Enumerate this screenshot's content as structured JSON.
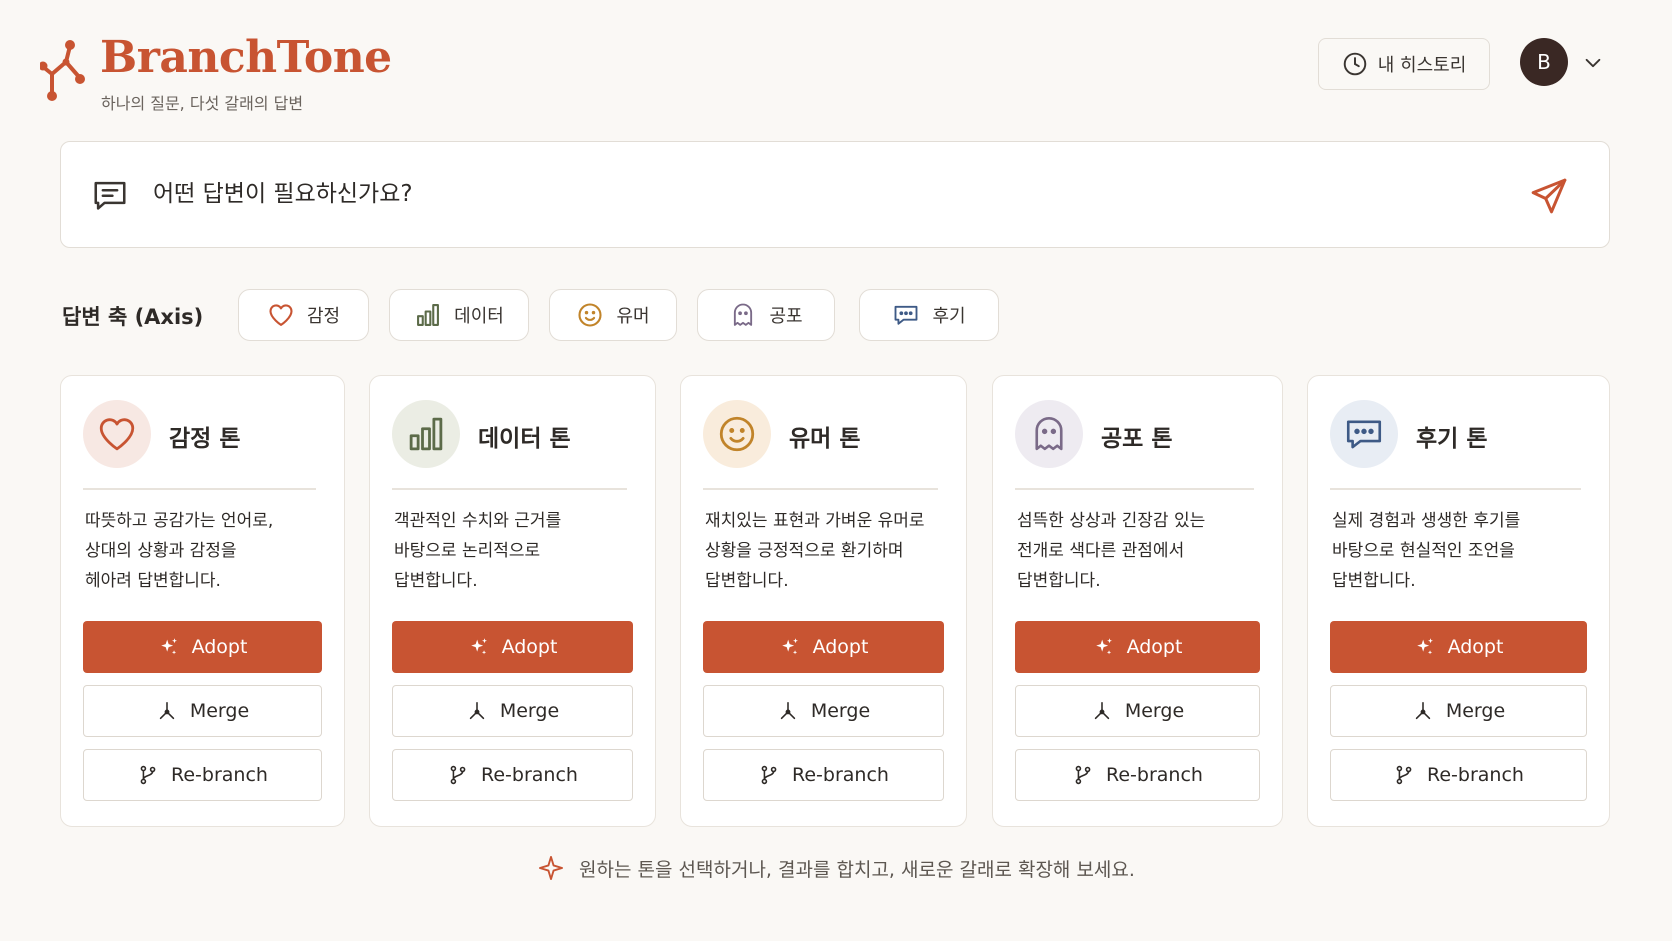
{
  "app": {
    "brand": "BranchTone",
    "tagline": "하나의 질문, 다섯 갈래의 답변",
    "accent_color": "#c85432",
    "logo_icon": "branch-nodes-icon"
  },
  "header": {
    "history_label": "내 히스토리",
    "history_icon": "clock-icon",
    "avatar_initial": "B",
    "menu_icon": "chevron-down-icon"
  },
  "search": {
    "placeholder": "어떤 답변이 필요하신가요?",
    "value": "",
    "left_icon": "chat-lines-icon",
    "send_icon": "send-icon"
  },
  "axis": {
    "label": "답변 축 (Axis)",
    "chips": [
      {
        "label": "감정",
        "icon": "heart-icon"
      },
      {
        "label": "데이터",
        "icon": "bar-chart-icon"
      },
      {
        "label": "유머",
        "icon": "smile-icon"
      },
      {
        "label": "공포",
        "icon": "ghost-icon"
      },
      {
        "label": "후기",
        "icon": "speech-bubble-icon"
      }
    ]
  },
  "cards": [
    {
      "title": "감정 톤",
      "icon": "heart-icon",
      "description": "따뜻하고 공감가는 언어로,\n상대의 상황과 감정을\n헤아려 답변합니다.",
      "adopt": "Adopt",
      "merge": "Merge",
      "rebranch": "Re-branch"
    },
    {
      "title": "데이터 톤",
      "icon": "bar-chart-icon",
      "description": "객관적인 수치와 근거를\n바탕으로 논리적으로\n답변합니다.",
      "adopt": "Adopt",
      "merge": "Merge",
      "rebranch": "Re-branch"
    },
    {
      "title": "유머 톤",
      "icon": "smile-icon",
      "description": "재치있는 표현과 가벼운 유머로\n상황을 긍정적으로 환기하며\n답변합니다.",
      "adopt": "Adopt",
      "merge": "Merge",
      "rebranch": "Re-branch"
    },
    {
      "title": "공포 톤",
      "icon": "ghost-icon",
      "description": "섬뜩한 상상과 긴장감 있는\n전개로 색다른 관점에서\n답변합니다.",
      "adopt": "Adopt",
      "merge": "Merge",
      "rebranch": "Re-branch"
    },
    {
      "title": "후기 톤",
      "icon": "speech-bubble-icon",
      "description": "실제 경험과 생생한 후기를\n바탕으로 현실적인 조언을\n답변합니다.",
      "adopt": "Adopt",
      "merge": "Merge",
      "rebranch": "Re-branch"
    }
  ],
  "footer": {
    "hint": "원하는 톤을 선택하거나, 결과를 합치고, 새로운 갈래로 확장해 보세요.",
    "hint_icon": "sparkle-icon"
  }
}
